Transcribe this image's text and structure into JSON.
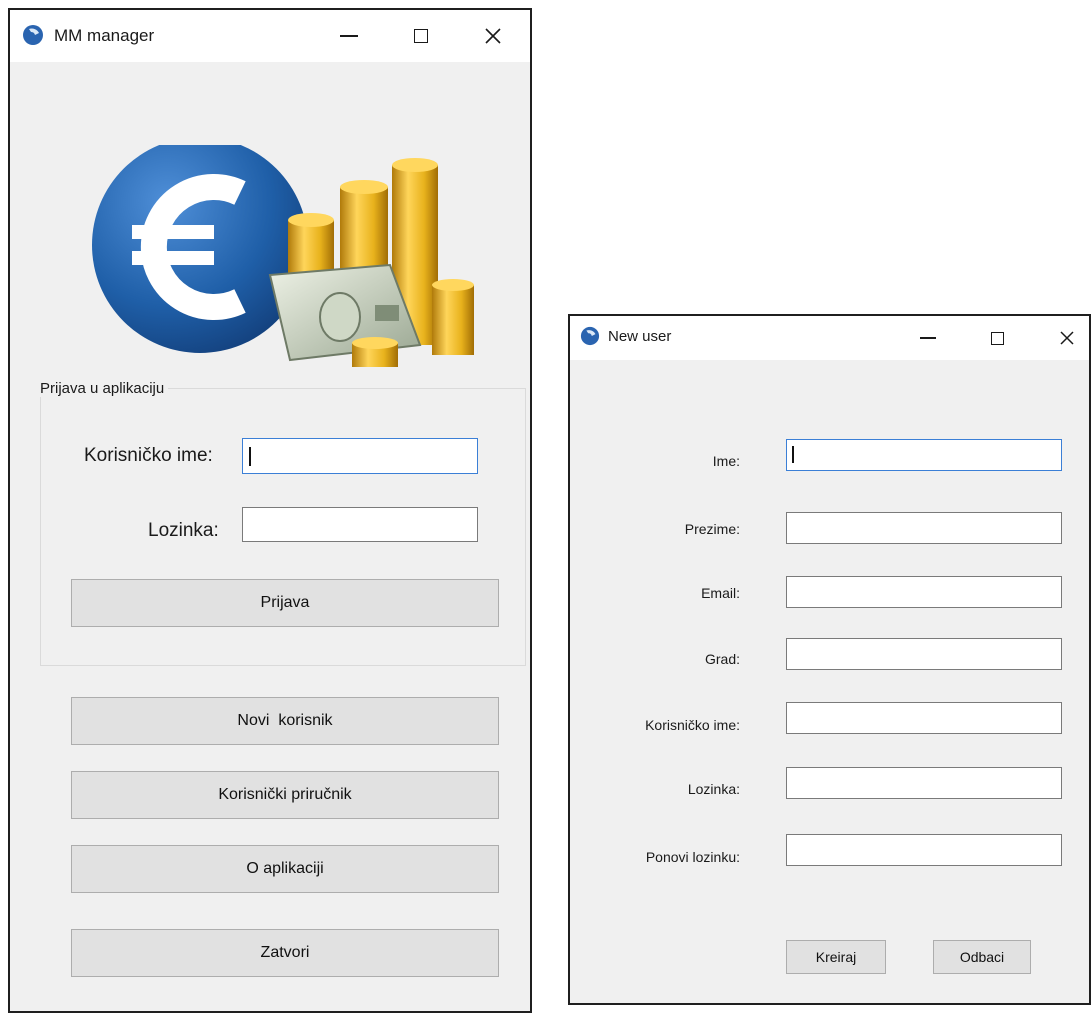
{
  "main_window": {
    "title": "MM manager",
    "login_group": {
      "legend": "Prijava u aplikaciju",
      "username_label": "Korisničko ime:",
      "username_value": "",
      "password_label": "Lozinka:",
      "password_value": "",
      "login_button": "Prijava"
    },
    "buttons": {
      "new_user": "Novi  korisnik",
      "user_manual": "Korisnički priručnik",
      "about": "O aplikaciji",
      "close": "Zatvori"
    }
  },
  "new_user_window": {
    "title": "New user",
    "fields": {
      "first_name_label": "Ime:",
      "last_name_label": "Prezime:",
      "email_label": "Email:",
      "city_label": "Grad:",
      "username_label": "Korisničko ime:",
      "password_label": "Lozinka:",
      "repeat_password_label": "Ponovi lozinku:"
    },
    "buttons": {
      "create": "Kreiraj",
      "discard": "Odbaci"
    }
  },
  "colors": {
    "window_bg": "#f0f0f0",
    "titlebar_bg": "#ffffff",
    "button_bg": "#e1e1e1",
    "focus_border": "#3b7fd6",
    "logo_blue": "#1f5fa8",
    "coin_gold": "#e8b21c"
  },
  "icons": [
    "app-icon",
    "minimize-icon",
    "maximize-icon",
    "close-icon",
    "euro-money-logo"
  ]
}
